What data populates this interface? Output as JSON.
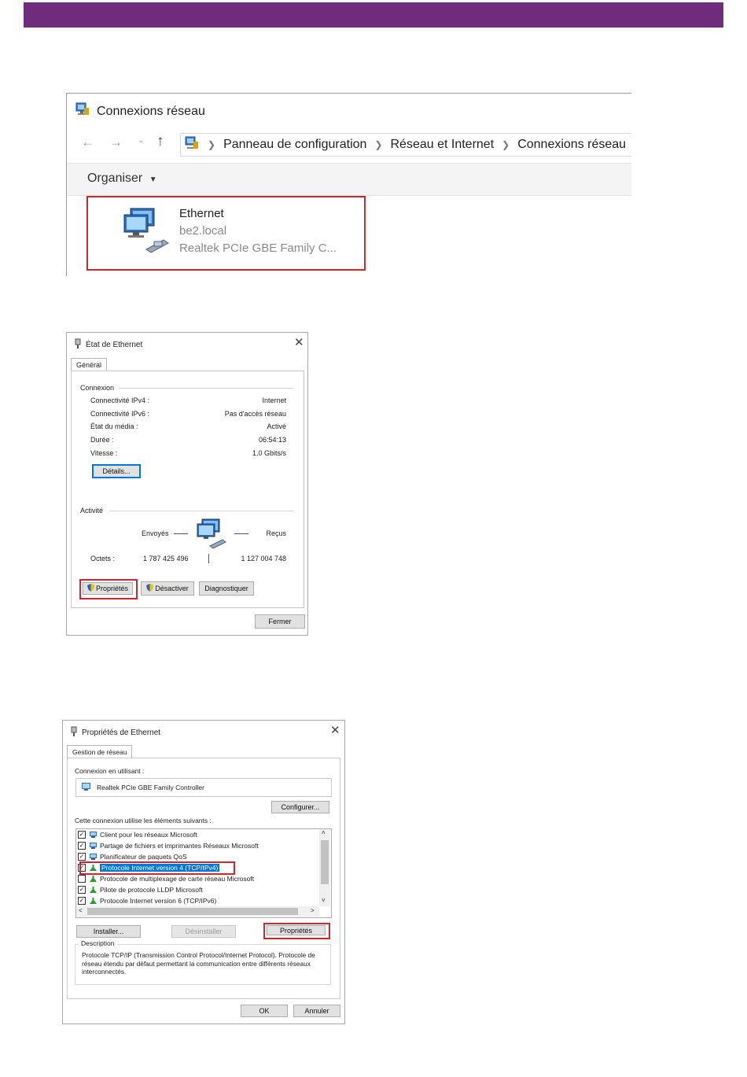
{
  "colors": {
    "header_bar": "#6f2c7d",
    "highlight": "#d0262f",
    "selection": "#0078d7"
  },
  "window1": {
    "title": "Connexions réseau",
    "nav": {
      "back_icon": "arrow-left-icon",
      "forward_icon": "arrow-right-icon",
      "up_icon": "arrow-up-icon"
    },
    "breadcrumb": [
      "Panneau de configuration",
      "Réseau et Internet",
      "Connexions réseau"
    ],
    "toolbar": {
      "organiser_label": "Organiser"
    },
    "adapter": {
      "name": "Ethernet",
      "domain": "be2.local",
      "device": "Realtek PCIe GBE Family C..."
    }
  },
  "status_dialog": {
    "title": "État de Ethernet",
    "tab": "Général",
    "connection": {
      "heading": "Connexion",
      "rows": [
        {
          "label": "Connectivité IPv4 :",
          "value": "Internet"
        },
        {
          "label": "Connectivité IPv6 :",
          "value": "Pas d'accès réseau"
        },
        {
          "label": "État du média :",
          "value": "Activé"
        },
        {
          "label": "Durée :",
          "value": "06:54:13"
        },
        {
          "label": "Vitesse :",
          "value": "1,0 Gbits/s"
        }
      ],
      "details_button": "Détails..."
    },
    "activity": {
      "heading": "Activité",
      "sent_label": "Envoyés",
      "received_label": "Reçus",
      "bytes_label": "Octets :",
      "bytes_sent": "1 787 425 496",
      "bytes_received": "1 127 004 748"
    },
    "buttons": {
      "properties": "Propriétés",
      "disable": "Désactiver",
      "diagnose": "Diagnostiquer",
      "close": "Fermer"
    }
  },
  "properties_dialog": {
    "title": "Propriétés de Ethernet",
    "tab": "Gestion de réseau",
    "connect_using_label": "Connexion en utilisant :",
    "adapter_name": "Realtek PCIe GBE Family Controller",
    "configure_button": "Configurer...",
    "items_label": "Cette connexion utilise les éléments suivants :",
    "items": [
      {
        "checked": true,
        "label": "Client pour les réseaux Microsoft",
        "icon": "network-client-icon"
      },
      {
        "checked": true,
        "label": "Partage de fichiers et imprimantes Réseaux Microsoft",
        "icon": "network-share-icon"
      },
      {
        "checked": true,
        "label": "Planificateur de paquets QoS",
        "icon": "network-client-icon"
      },
      {
        "checked": true,
        "label": "Protocole Internet version 4 (TCP/IPv4)",
        "icon": "protocol-icon",
        "selected": true
      },
      {
        "checked": false,
        "label": "Protocole de multiplexage de carte réseau Microsoft",
        "icon": "protocol-icon"
      },
      {
        "checked": true,
        "label": "Pilote de protocole LLDP Microsoft",
        "icon": "protocol-icon"
      },
      {
        "checked": true,
        "label": "Protocole Internet version 6 (TCP/IPv6)",
        "icon": "protocol-icon"
      }
    ],
    "buttons": {
      "install": "Installer...",
      "uninstall": "Désinstaller",
      "properties": "Propriétés",
      "ok": "OK",
      "cancel": "Annuler"
    },
    "description_heading": "Description",
    "description_text": "Protocole TCP/IP (Transmission Control Protocol/Internet Protocol). Protocole de réseau étendu par défaut permettant la communication entre différents réseaux interconnectés."
  }
}
